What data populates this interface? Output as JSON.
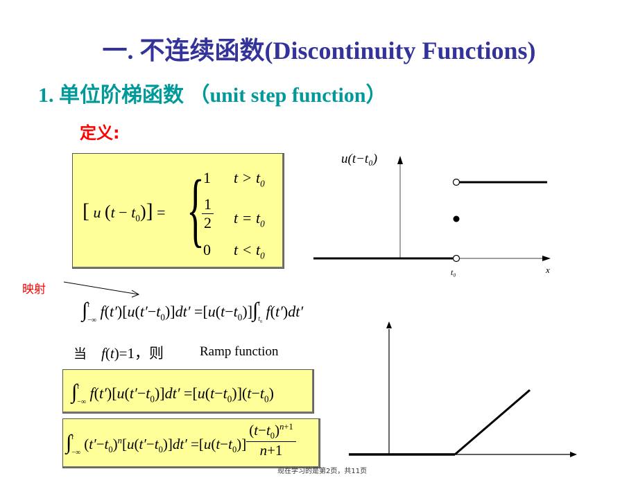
{
  "slide": {
    "title": "一.  不连续函数(Discontinuity Functions)",
    "subtitle": "1. 单位阶梯函数 （unit step function）",
    "definition_label": "定义:",
    "mapping_label": "映射",
    "when_label": "当",
    "when_condition": "f(t)=1，则",
    "ramp_label": "Ramp function",
    "footer": "现在学习的是第2页，共11页"
  },
  "definition": {
    "lhs": "[u(t − t₀)] =",
    "cases": [
      {
        "value": "1",
        "condition": "t > t₀"
      },
      {
        "value": "1/2",
        "condition": "t = t₀"
      },
      {
        "value": "0",
        "condition": "t < t₀"
      }
    ]
  },
  "equations": {
    "integral_identity": "∫_{-∞}^{t} f(t′)[u(t′−t₀)]dt′ = [u(t−t₀)]∫_{t₀}^{t} f(t′)dt′",
    "ramp_identity": "∫_{-∞}^{t} f(t′)[u(t′−t₀)]dt′ = [u(t−t₀)](t−t₀)",
    "power_identity": "∫_{-∞}^{t} (t′−t₀)^n [u(t′−t₀)]dt′ = [u(t−t₀)] (t−t₀)^{n+1}/(n+1)"
  },
  "step_plot": {
    "y_label": "u(t−t₀)",
    "x_label": "x",
    "t0_label": "t₀",
    "low_value": 0,
    "mid_value": 0.5,
    "high_value": 1
  },
  "ramp_plot": {
    "description": "zero until t0, then linear increase"
  }
}
